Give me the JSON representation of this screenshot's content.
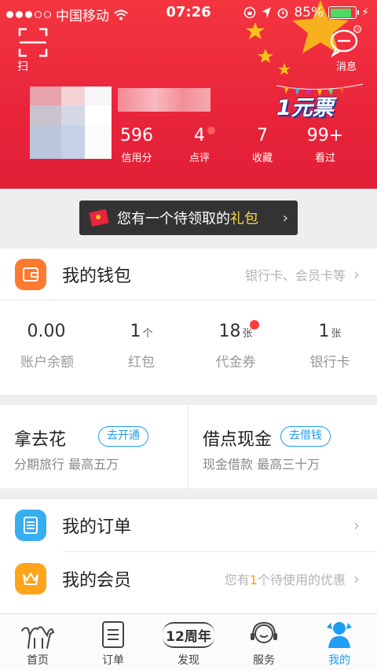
{
  "status_bar": {
    "carrier": "中国移动",
    "time": "07:26",
    "battery_percent": "85%",
    "battery_level": 0.85
  },
  "header": {
    "scan_label": "扫",
    "messages_label": "消息",
    "promo_text": "1元票",
    "stats": [
      {
        "value": "596",
        "label": "信用分",
        "dot": false
      },
      {
        "value": "4",
        "label": "点评",
        "dot": true
      },
      {
        "value": "7",
        "label": "收藏",
        "dot": false
      },
      {
        "value": "99+",
        "label": "看过",
        "dot": false
      }
    ]
  },
  "gift_banner": {
    "text_prefix": "您有一个待领取的",
    "text_highlight": "礼包",
    "chevron": "›"
  },
  "wallet": {
    "title": "我的钱包",
    "hint": "银行卡、会员卡等",
    "stats": [
      {
        "value": "0.00",
        "unit": "",
        "label": "账户余额",
        "dot": false
      },
      {
        "value": "1",
        "unit": "个",
        "label": "红包",
        "dot": false
      },
      {
        "value": "18",
        "unit": "张",
        "label": "代金券",
        "dot": true
      },
      {
        "value": "1",
        "unit": "张",
        "label": "银行卡",
        "dot": false
      }
    ]
  },
  "credit": {
    "left": {
      "title": "拿去花",
      "pill": "去开通",
      "subtitle": "分期旅行 最高五万"
    },
    "right": {
      "title": "借点现金",
      "pill": "去借钱",
      "subtitle": "现金借款 最高三十万"
    }
  },
  "orders": {
    "title": "我的订单"
  },
  "membership": {
    "title": "我的会员",
    "hint_prefix": "您有",
    "hint_count": "1",
    "hint_suffix": "个待使用的优惠"
  },
  "tabbar": {
    "tabs": [
      {
        "label": "首页",
        "icon": "camel-icon"
      },
      {
        "label": "订单",
        "icon": "order-list-icon"
      },
      {
        "label": "发现",
        "icon": "anniversary-12-icon",
        "icon_text": "12周年"
      },
      {
        "label": "服务",
        "icon": "customer-service-icon"
      },
      {
        "label": "我的",
        "icon": "profile-icon"
      }
    ],
    "active_index": 4
  },
  "colors": {
    "header_red": "#e9243b",
    "accent_blue": "#1e9ef2",
    "wallet_orange": "#ff7a30",
    "orders_blue": "#37aef0",
    "member_orange": "#ffa41b"
  }
}
